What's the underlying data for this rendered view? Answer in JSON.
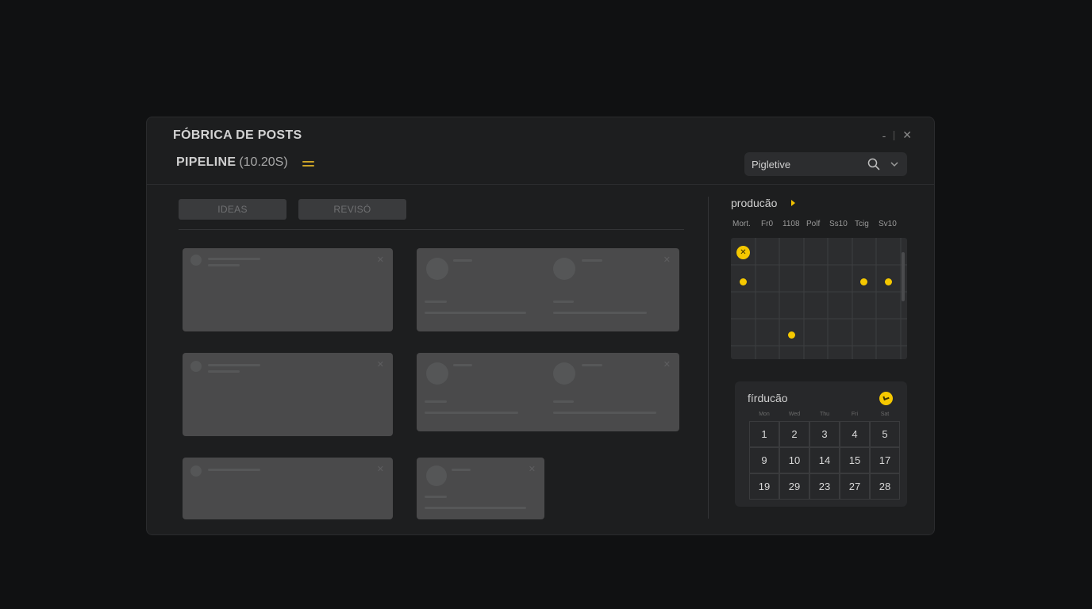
{
  "window": {
    "app_title": "FÓBRICA DE POSTS",
    "pipeline_title": "PIPELINE",
    "pipeline_count": "(10.20S)",
    "controls": {
      "minimize": "-",
      "close": "✕"
    }
  },
  "search": {
    "value": "Pigletive"
  },
  "tabs": [
    {
      "label": "IDEAS"
    },
    {
      "label": "REVISÓ"
    }
  ],
  "production": {
    "title": "producão",
    "days": [
      "Mort.",
      "Fr0",
      "1108",
      "Polf",
      "Ss10",
      "Tcig",
      "Sv10"
    ]
  },
  "calendar": {
    "title": "fírducão",
    "weekdays": [
      "Mon",
      "Wed",
      "Thu",
      "Fri",
      "Sat"
    ],
    "rows": [
      [
        "1",
        "2",
        "3",
        "4",
        "5"
      ],
      [
        "9",
        "10",
        "14",
        "15",
        "17"
      ],
      [
        "19",
        "29",
        "23",
        "27",
        "28"
      ]
    ]
  },
  "colors": {
    "accent": "#f5c800",
    "window_bg": "#1d1e1f",
    "card_bg": "#4a4a4b",
    "page_bg": "#101112"
  }
}
